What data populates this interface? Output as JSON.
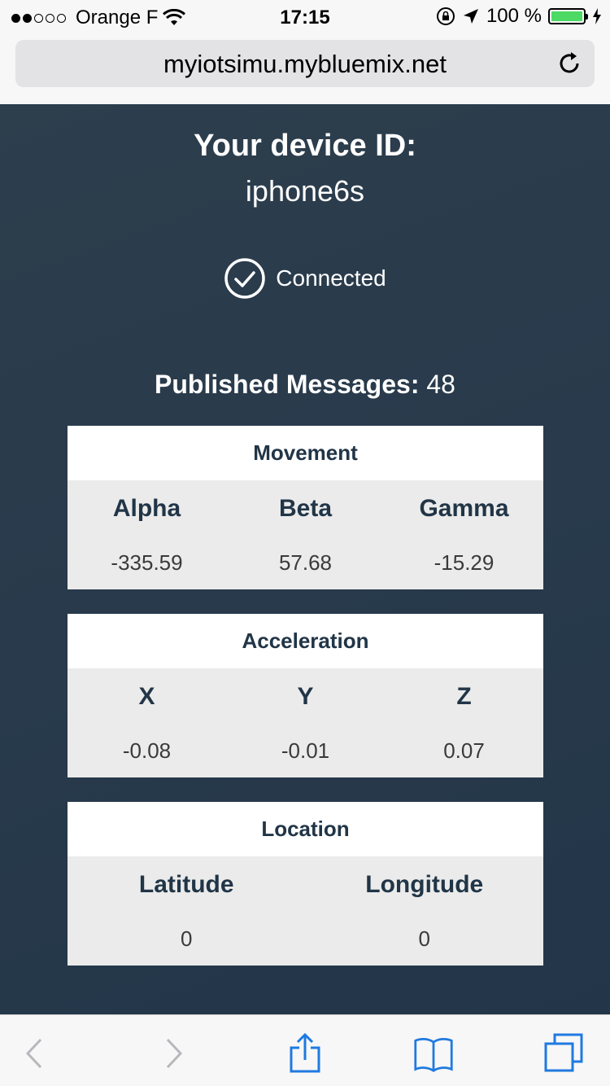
{
  "statusbar": {
    "carrier": "Orange F",
    "time": "17:15",
    "battery": "100 %"
  },
  "browser": {
    "url": "myiotsimu.mybluemix.net"
  },
  "page": {
    "title": "Your device ID:",
    "device_id": "iphone6s",
    "connection_status": "Connected",
    "published_label": "Published Messages:",
    "published_count": "48"
  },
  "movement": {
    "title": "Movement",
    "labels": [
      "Alpha",
      "Beta",
      "Gamma"
    ],
    "values": [
      "-335.59",
      "57.68",
      "-15.29"
    ]
  },
  "acceleration": {
    "title": "Acceleration",
    "labels": [
      "X",
      "Y",
      "Z"
    ],
    "values": [
      "-0.08",
      "-0.01",
      "0.07"
    ]
  },
  "location": {
    "title": "Location",
    "labels": [
      "Latitude",
      "Longitude"
    ],
    "values": [
      "0",
      "0"
    ]
  },
  "colors": {
    "background": "#2d3e4d",
    "accent": "#213547",
    "battery": "#4cd964",
    "toolbar_icon": "#1f7ae0"
  },
  "icons": [
    "wifi-icon",
    "lock-rotation-icon",
    "location-arrow-icon",
    "battery-icon",
    "charging-icon",
    "reload-icon",
    "check-circle-icon",
    "back-icon",
    "forward-icon",
    "share-icon",
    "bookmarks-icon",
    "tabs-icon"
  ]
}
